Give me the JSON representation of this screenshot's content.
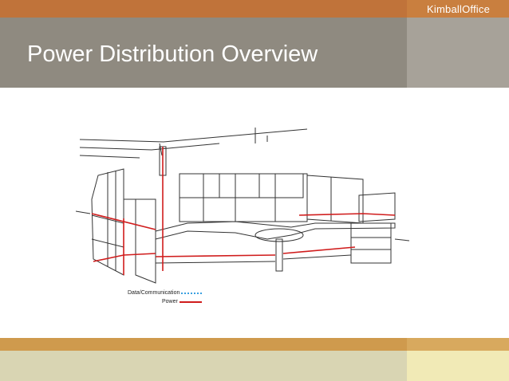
{
  "header": {
    "brand_primary": "Kimball",
    "brand_secondary": "Office",
    "title": "Power Distribution Overview"
  },
  "legend": {
    "data_label": "Data/Communication",
    "power_label": "Power"
  },
  "colors": {
    "top_bar": "#c0733a",
    "title_band": "#8f8a80",
    "bottom_bar": "#cf9a4d",
    "footer_band": "#d9d5b3",
    "power_line": "#d01c1c",
    "data_line": "#3aa0e0"
  },
  "icons": {
    "illustration": "office-workstation-drawing"
  }
}
